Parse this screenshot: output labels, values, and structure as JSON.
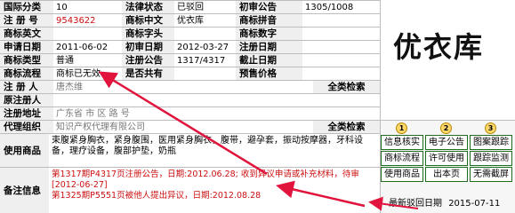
{
  "rows": [
    [
      {
        "l": "国际分类"
      },
      {
        "v": "10"
      },
      {
        "l": "法律状态"
      },
      {
        "v": "已驳回"
      },
      {
        "l": "初审公告"
      },
      {
        "v": "1305/1008"
      }
    ],
    [
      {
        "l": "注 册 号"
      },
      {
        "v": "9543622",
        "red": true
      },
      {
        "l": "商标中文"
      },
      {
        "v": "优衣库"
      },
      {
        "l": "商标拼音"
      },
      {
        "v": ""
      }
    ],
    [
      {
        "l": "商标英文"
      },
      {
        "v": ""
      },
      {
        "l": "商标字头"
      },
      {
        "v": ""
      },
      {
        "l": "商标数字"
      },
      {
        "v": ""
      }
    ],
    [
      {
        "l": "申请日期"
      },
      {
        "v": "2011-06-02"
      },
      {
        "l": "初审日期"
      },
      {
        "v": "2012-03-27"
      },
      {
        "l": "注册日期"
      },
      {
        "v": ""
      }
    ],
    [
      {
        "l": "商标类型"
      },
      {
        "v": "普通"
      },
      {
        "l": "注册公告"
      },
      {
        "v": "1317/4317"
      },
      {
        "l": "截止日期"
      },
      {
        "v": ""
      }
    ],
    [
      {
        "l": "商标流程"
      },
      {
        "v": "商标已无效"
      },
      {
        "l": "是否共有"
      },
      {
        "v": ""
      },
      {
        "l": "预售价格"
      },
      {
        "v": ""
      }
    ]
  ],
  "applicant_label": "注 册 人",
  "applicant_value": "唐杰维",
  "orig_reg_label": "原注册人",
  "search1": "全类检索",
  "address_label": "注册地址",
  "address_value": "广东省  市  区  路  号",
  "agent_label": "代理组织",
  "agent_value": "  知识产权代理有限公司",
  "search2": "全类检索",
  "trademark_image_text": "优衣库",
  "goods_label": "使用商品",
  "goods_value": "束腹紧身胸衣，紧身腹围，医用紧身胸衣，腹带，避孕套，振动按摩器，牙科设备，理疗设备，腹部护垫，奶瓶",
  "notes_label": "备注信息",
  "notes": [
    "第1317期P4317页注册公告，日期:2012.06.28; 收到异议申请或补充材料，待审[2012-06-27]",
    "第1325期P5551页被他人提出异议，日期:2012.08.28"
  ],
  "buttons": [
    {
      "num": "1",
      "label": "信息核实"
    },
    {
      "num": "2",
      "label": "电子公告"
    },
    {
      "num": "3",
      "label": "图案跟踪"
    },
    {
      "label": "商标流程"
    },
    {
      "label": "许可使用"
    },
    {
      "label": "跟踪监测"
    },
    {
      "label": "使用商品"
    },
    {
      "label": "出本页"
    },
    {
      "label": "无需截屏"
    }
  ],
  "footer_label": "最新驳回日期",
  "footer_value": "2015-07-11",
  "colors": {
    "accent_red": "#cc1010",
    "label_bg": "#efefef",
    "button_border": "#1e6e1e",
    "arrow": "#e0143c"
  }
}
